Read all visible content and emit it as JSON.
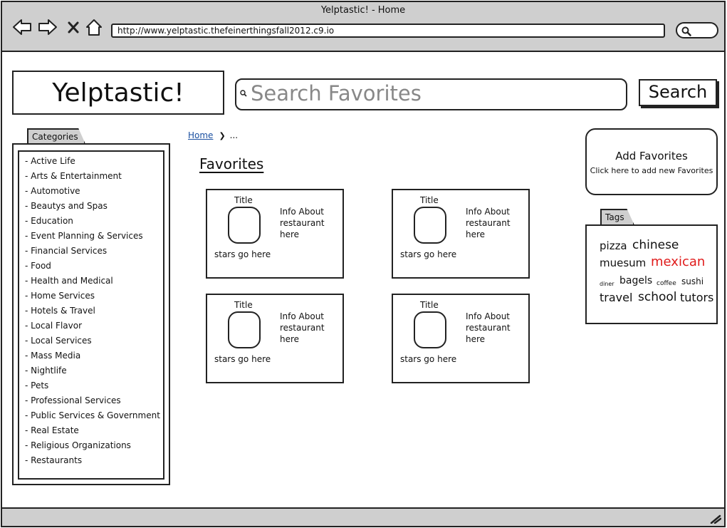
{
  "window": {
    "title": "Yelptastic! - Home"
  },
  "browser": {
    "url": "http://www.yelptastic.thefeinerthingsfall2012.c9.io"
  },
  "header": {
    "logo": "Yelptastic!",
    "search_placeholder": "Search Favorites",
    "search_button": "Search"
  },
  "sidebar": {
    "tab_label": "Categories",
    "items": [
      {
        "label": "- Active Life"
      },
      {
        "label": "- Arts & Entertainment"
      },
      {
        "label": "- Automotive"
      },
      {
        "label": "- Beautys and Spas"
      },
      {
        "label": "- Education"
      },
      {
        "label": "- Event Planning & Services"
      },
      {
        "label": "- Financial Services"
      },
      {
        "label": "- Food"
      },
      {
        "label": "- Health and Medical"
      },
      {
        "label": "- Home Services"
      },
      {
        "label": "- Hotels & Travel"
      },
      {
        "label": "- Local Flavor"
      },
      {
        "label": "- Local Services"
      },
      {
        "label": "- Mass Media"
      },
      {
        "label": "- Nightlife"
      },
      {
        "label": "- Pets"
      },
      {
        "label": "- Professional Services"
      },
      {
        "label": "- Public Services & Government"
      },
      {
        "label": "- Real Estate"
      },
      {
        "label": "- Religious Organizations"
      },
      {
        "label": "- Restaurants"
      }
    ]
  },
  "breadcrumb": {
    "home": "Home",
    "rest": "..."
  },
  "main": {
    "heading": "Favorites",
    "cards": [
      {
        "title": "Title",
        "info": "Info About restaurant here",
        "stars": "stars go here"
      },
      {
        "title": "Title",
        "info": "Info About restaurant here",
        "stars": "stars go here"
      },
      {
        "title": "Title",
        "info": "Info About restaurant here",
        "stars": "stars go here"
      },
      {
        "title": "Title",
        "info": "Info About restaurant here",
        "stars": "stars go here"
      }
    ]
  },
  "add_favorites": {
    "heading": "Add Favorites",
    "subtext": "Click here to add new Favorites"
  },
  "tags": {
    "tab_label": "Tags",
    "items": [
      {
        "label": "pizza"
      },
      {
        "label": "chinese"
      },
      {
        "label": "muesum"
      },
      {
        "label": "mexican",
        "color": "#e01b1b"
      },
      {
        "label": "diner"
      },
      {
        "label": "bagels"
      },
      {
        "label": "coffee"
      },
      {
        "label": "sushi"
      },
      {
        "label": "travel"
      },
      {
        "label": "school"
      },
      {
        "label": "tutors"
      }
    ]
  }
}
